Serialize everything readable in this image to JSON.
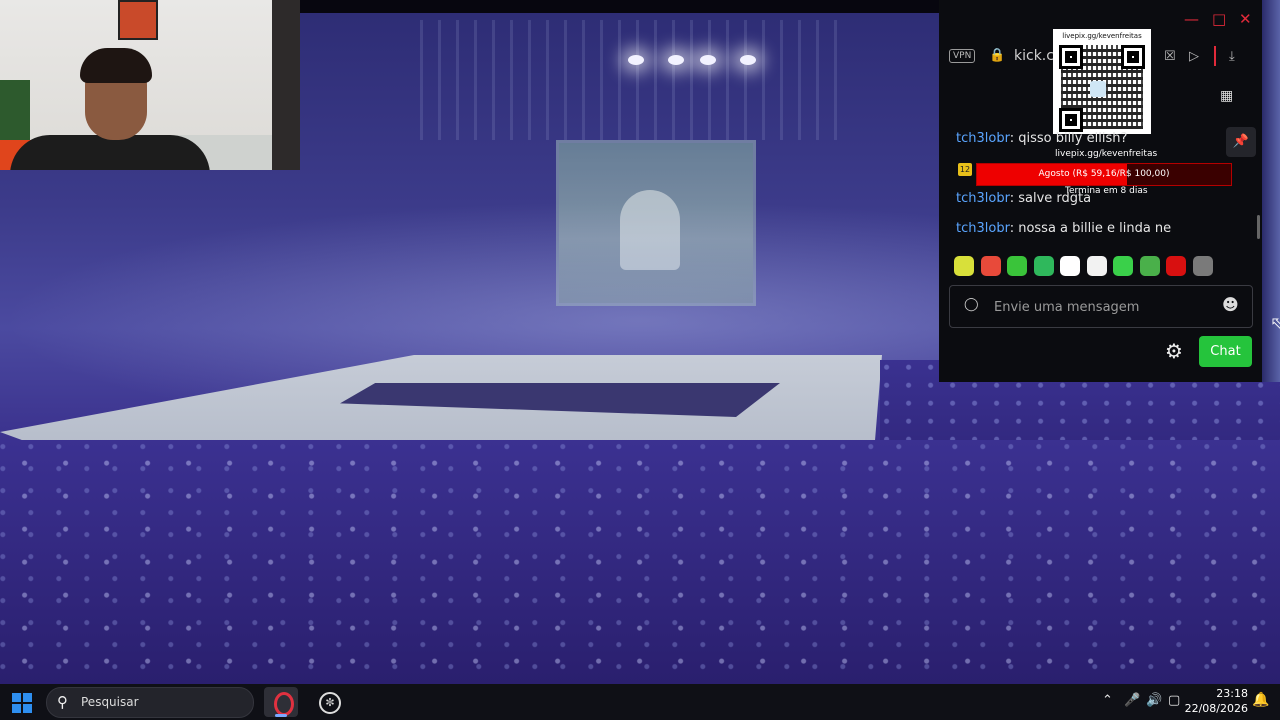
{
  "browser": {
    "address": "kick.co",
    "vpn_label": "VPN"
  },
  "overlay": {
    "qr_top_text": "livepix.gg/kevenfreitas",
    "qr_bottom_text": "livepix.gg/kevenfreitas",
    "goal_badge": "12",
    "goal_text": "Agosto (R$ 59,16/R$ 100,00)",
    "goal_progress": 0.5916,
    "goal_subtext": "Termina em 8 dias"
  },
  "chat": {
    "messages": [
      {
        "user": "tch3lobr",
        "text": ": qisso billy ellish?"
      },
      {
        "user": "tch3lobr",
        "text": ": salve rdgta"
      },
      {
        "user": "tch3lobr",
        "text": ": nossa a billie e linda ne"
      }
    ],
    "input_placeholder": "Envie uma mensagem",
    "send_label": "Chat",
    "emote_colors": [
      "#d8e03a",
      "#e84a3a",
      "#3ac43a",
      "#2fb85c",
      "#ffffff",
      "#f2f2f2",
      "#3ad04a",
      "#4ab04a",
      "#d81010",
      "#7a7a7a"
    ]
  },
  "taskbar": {
    "search_placeholder": "Pesquisar",
    "time": "23:18",
    "date": "22/08/2026"
  }
}
